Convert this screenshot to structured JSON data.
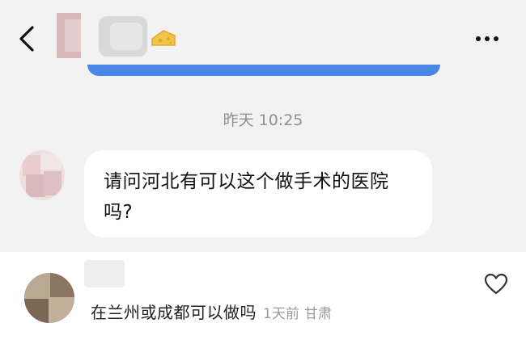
{
  "header": {
    "back_icon": "chevron-left-icon",
    "more_icon": "more-horizontal-icon",
    "badge_icon": "cheese-badge-icon",
    "accent_color": "#4a86e6"
  },
  "chat": {
    "timestamp": "昨天 10:25",
    "message": "请问河北有可以这个做手术的医院吗?"
  },
  "comment": {
    "text": "在兰州或成都可以做吗",
    "time": "1天前",
    "location": "甘肃",
    "like_icon": "heart-outline-icon"
  }
}
